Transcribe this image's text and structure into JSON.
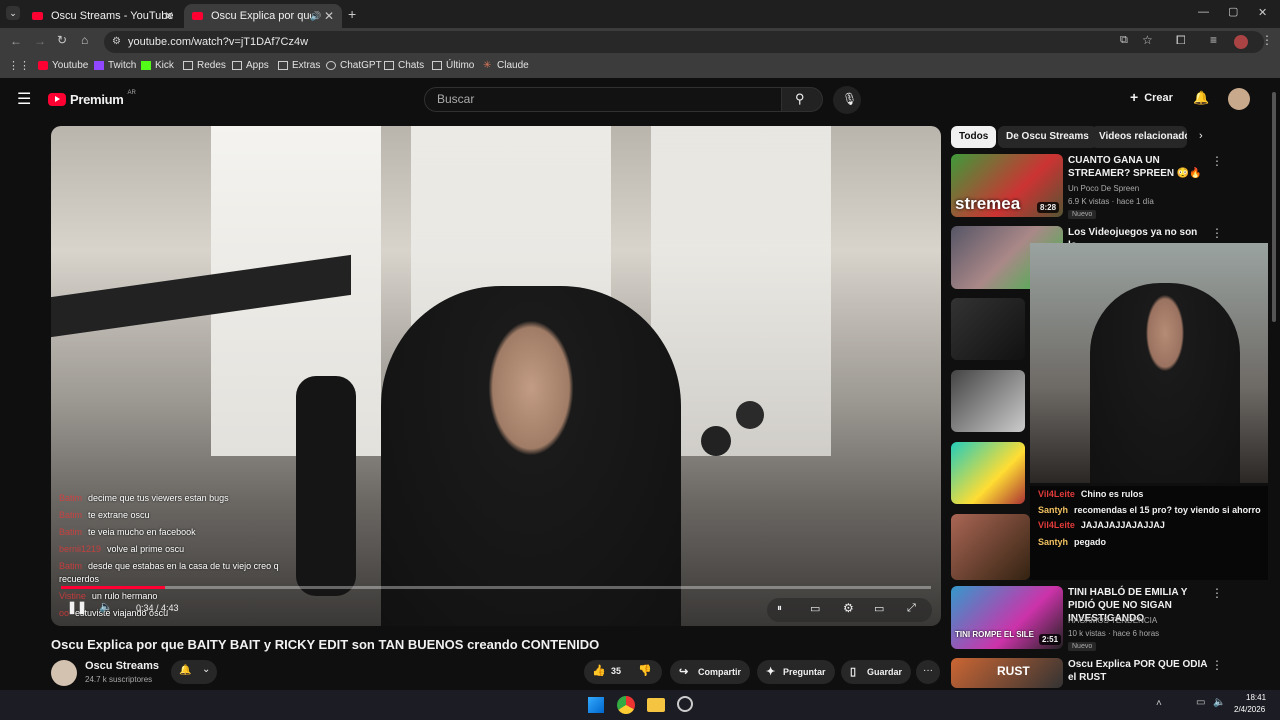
{
  "browser": {
    "tabs": [
      {
        "label": "Oscu Streams - YouTube"
      },
      {
        "label": "Oscu Explica por que BAITY"
      }
    ],
    "url": "youtube.com/watch?v=jT1DAf7Cz4w",
    "bookmarks": [
      "Youtube",
      "Twitch",
      "Kick",
      "Redes",
      "Apps",
      "Extras",
      "ChatGPT",
      "Chats",
      "Último",
      "Claude"
    ]
  },
  "youtube": {
    "logo_text": "Premium",
    "region": "AR",
    "search_placeholder": "Buscar",
    "create_label": "Crear"
  },
  "player": {
    "time": "0:34 / 4:43",
    "chat": [
      {
        "user": "Batim",
        "msg": "decime que tus viewers estan bugs"
      },
      {
        "user": "Batim",
        "msg": "te extrane oscu"
      },
      {
        "user": "Batim",
        "msg": "te veia mucho en facebook"
      },
      {
        "user": "bernii1219",
        "msg": "volve al prime oscu"
      },
      {
        "user": "Batim",
        "msg": "desde que estabas en la casa de tu viejo creo q recuerdos"
      },
      {
        "user": "Vistine",
        "msg": "un rulo hermano"
      },
      {
        "user": "oo",
        "msg": "estuviste viajando oscu"
      }
    ],
    "progress_fraction": 0.12
  },
  "video": {
    "title": "Oscu Explica por que BAITY BAIT y RICKY EDIT son TAN BUENOS creando CONTENIDO",
    "channel": "Oscu Streams",
    "subscribers": "24.7 k suscriptores",
    "likes": "35",
    "share_label": "Compartir",
    "ask_label": "Preguntar",
    "save_label": "Guardar"
  },
  "sidebar": {
    "chips": [
      "Todos",
      "De Oscu Streams",
      "Videos relacionados"
    ],
    "videos": [
      {
        "title": "CUANTO GANA UN STREAMER? SPREEN 😳🔥",
        "channel": "Un Poco De Spreen",
        "stats": "6.9 K vistas · hace 1 día",
        "badge": "Nuevo",
        "duration": "8:28",
        "thumb_text": "stremea"
      },
      {
        "title": "Los Videojuegos ya no son lo",
        "channel": "",
        "stats": "",
        "badge": "",
        "duration": "",
        "thumb_text": ""
      },
      {
        "title": "TINI HABLÓ DE EMILIA Y PIDIÓ QUE NO SIGAN INVESTIGANDO",
        "channel": "HAGAMOS TENDENCIA",
        "stats": "10 k vistas · hace 6 horas",
        "badge": "Nuevo",
        "duration": "2:51",
        "thumb_text": "TINI ROMPE EL SILE"
      },
      {
        "title": "Oscu Explica POR QUE ODIA el RUST",
        "channel": "",
        "stats": "",
        "badge": "",
        "duration": "",
        "thumb_text": "RUST"
      }
    ]
  },
  "overlay_chat": [
    {
      "user": "Vil4Leite",
      "msg": "Chino es rulos"
    },
    {
      "user": "Santyh",
      "msg": "recomendas el 15 pro? toy viendo si ahorro"
    },
    {
      "user": "Vil4Leite",
      "msg": "JAJAJAJJAJAJJAJ"
    },
    {
      "user": "Santyh",
      "msg": "pegado"
    }
  ],
  "taskbar": {
    "time": "18:41",
    "date": "2/4/2026"
  },
  "colors": {
    "accent": "#ff0033",
    "bg": "#0f0f0f"
  }
}
